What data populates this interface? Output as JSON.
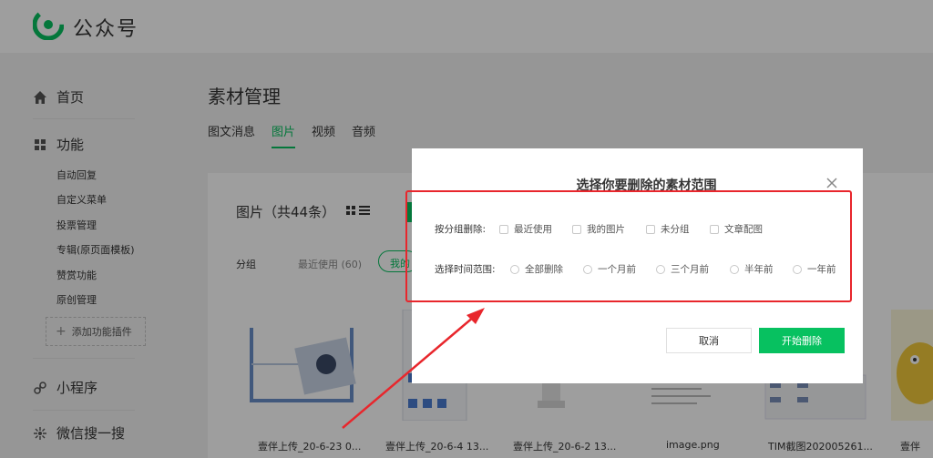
{
  "app": {
    "brand": "公众号"
  },
  "sidebar": {
    "home": "首页",
    "features": "功能",
    "sub_items": [
      "自动回复",
      "自定义菜单",
      "投票管理",
      "专辑(原页面模板)",
      "赞赏功能",
      "原创管理"
    ],
    "add_plugin": "添加功能插件",
    "mini_program": "小程序",
    "wechat_search": "微信搜一搜"
  },
  "main": {
    "title": "素材管理",
    "tabs": [
      "图文消息",
      "图片",
      "视频",
      "音频"
    ],
    "active_tab": "图片",
    "pics_title": "图片（共44条）",
    "group_label": "分组",
    "recent_chip": "最近使用 (60)",
    "mine_chip": "我的图片"
  },
  "thumbnails": [
    {
      "caption": "壹伴上传_20-6-23 0..."
    },
    {
      "caption": "壹伴上传_20-6-4 13..."
    },
    {
      "caption": "壹伴上传_20-6-2 13..."
    },
    {
      "caption": "image.png"
    },
    {
      "caption": "TIM截图202005261..."
    },
    {
      "caption": "壹伴"
    }
  ],
  "modal": {
    "title": "选择你要删除的素材范围",
    "group_row_label": "按分组删除:",
    "group_options": [
      "最近使用",
      "我的图片",
      "未分组",
      "文章配图"
    ],
    "time_row_label": "选择时间范围:",
    "time_options": [
      "全部删除",
      "一个月前",
      "三个月前",
      "半年前",
      "一年前"
    ],
    "cancel": "取消",
    "start": "开始删除"
  },
  "colors": {
    "accent": "#07c160",
    "annotation": "#e8262c"
  }
}
